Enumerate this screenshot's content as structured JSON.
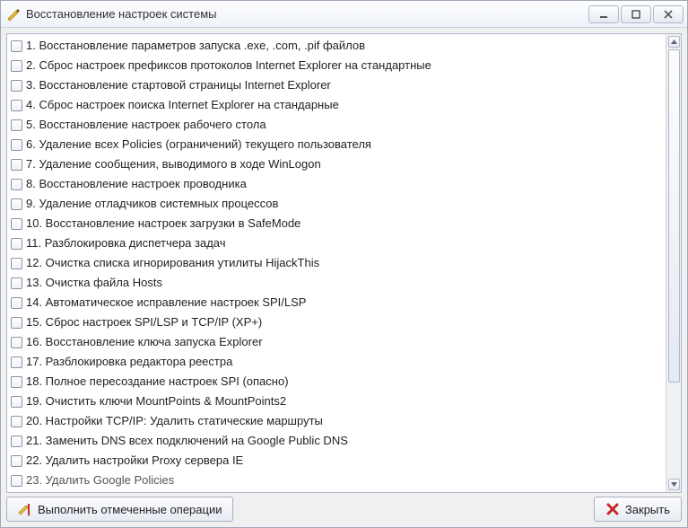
{
  "window": {
    "title": "Восстановление настроек системы"
  },
  "list": {
    "items": [
      "1. Восстановление параметров запуска .exe, .com, .pif файлов",
      "2. Сброс настроек префиксов протоколов Internet Explorer на стандартные",
      "3. Восстановление стартовой страницы Internet Explorer",
      "4. Сброс настроек поиска Internet Explorer на стандарные",
      "5. Восстановление настроек рабочего стола",
      "6. Удаление всех Policies (ограничений) текущего пользователя",
      "7. Удаление сообщения, выводимого в ходе WinLogon",
      "8. Восстановление настроек проводника",
      "9. Удаление отладчиков системных процессов",
      "10. Восстановление настроек загрузки в SafeMode",
      "11. Разблокировка диспетчера задач",
      "12. Очистка списка игнорирования утилиты HijackThis",
      "13. Очистка файла Hosts",
      "14. Автоматическое исправление настроек SPI/LSP",
      "15. Сброс настроек SPI/LSP и TCP/IP (XP+)",
      "16. Восстановление ключа запуска Explorer",
      "17. Разблокировка редактора реестра",
      "18. Полное пересоздание настроек SPI (опасно)",
      "19. Очистить ключи MountPoints & MountPoints2",
      "20. Настройки TCP/IP: Удалить статические маршруты",
      "21. Заменить DNS всех подключений на Google Public DNS",
      "22. Удалить настройки Proxy сервера IE",
      "23. Удалить Google Policies"
    ]
  },
  "buttons": {
    "execute": "Выполнить отмеченные операции",
    "close": "Закрыть"
  }
}
